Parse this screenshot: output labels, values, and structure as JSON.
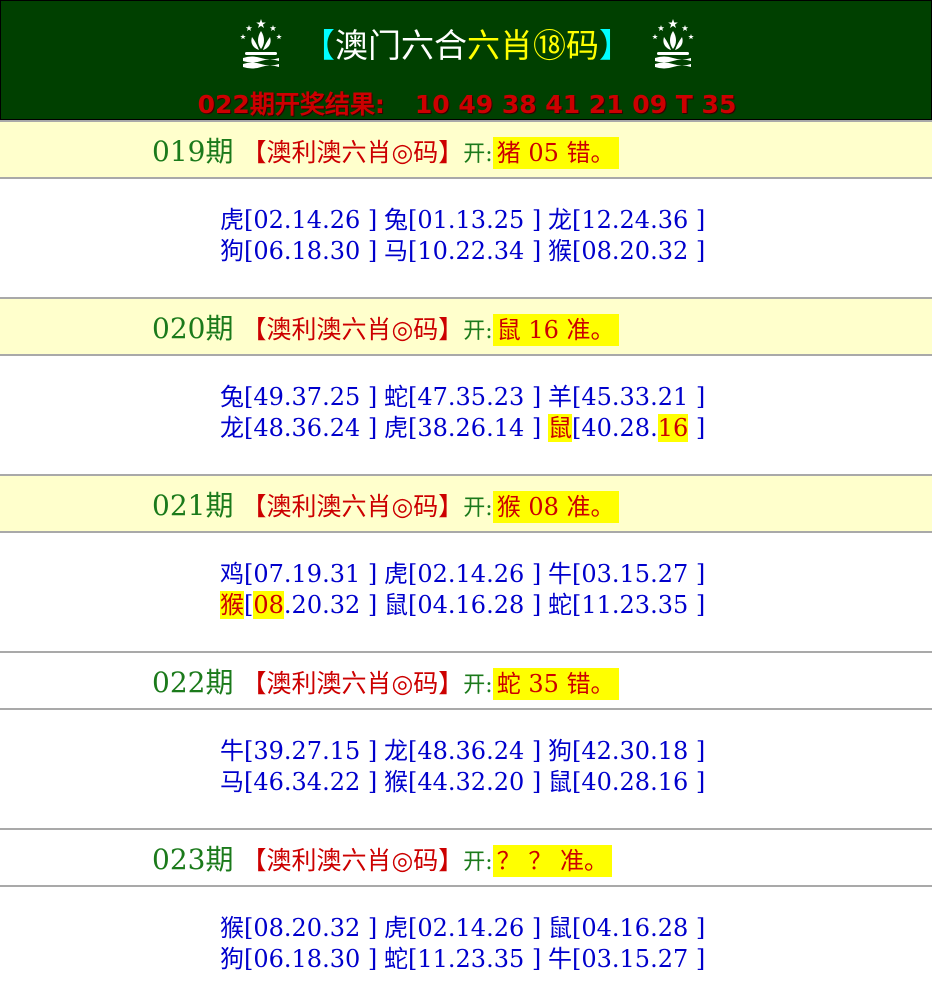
{
  "header": {
    "title_open": "【",
    "title_a": "澳门六合",
    "title_b": "六肖⑱码",
    "title_close": "】",
    "result_label": "022期开奖结果:",
    "result_numbers": "10 49 38 41 21 09 T 35"
  },
  "periods": [
    {
      "number": "019期",
      "bracket": "【澳利澳六肖◎码】",
      "kai": "开:",
      "result": "猪 05 错。",
      "head_bg": "#ffffcc",
      "rows": [
        [
          {
            "z": "虎",
            "n": [
              "[02.14.26 ]"
            ]
          },
          {
            "z": "兔",
            "n": [
              "[01.13.25 ]"
            ]
          },
          {
            "z": "龙",
            "n": [
              "[12.24.36 ]"
            ]
          }
        ],
        [
          {
            "z": "狗",
            "n": [
              "[06.18.30 ]"
            ]
          },
          {
            "z": "马",
            "n": [
              "[10.22.34 ]"
            ]
          },
          {
            "z": "猴",
            "n": [
              "[08.20.32 ]"
            ]
          }
        ]
      ]
    },
    {
      "number": "020期",
      "bracket": "【澳利澳六肖◎码】",
      "kai": "开:",
      "result": "鼠 16 准。",
      "head_bg": "#ffffcc",
      "rows": [
        [
          {
            "z": "兔",
            "n": [
              "[49.37.25 ]"
            ]
          },
          {
            "z": "蛇",
            "n": [
              "[47.35.23 ]"
            ]
          },
          {
            "z": "羊",
            "n": [
              "[45.33.21 ]"
            ]
          }
        ],
        [
          {
            "z": "龙",
            "n": [
              "[48.36.24 ]"
            ]
          },
          {
            "z": "虎",
            "n": [
              "[38.26.14 ]"
            ]
          },
          {
            "z": "鼠",
            "hit": true,
            "n": [
              "[40.28.",
              "16",
              " ]"
            ],
            "hitIndex": 1
          }
        ]
      ]
    },
    {
      "number": "021期",
      "bracket": "【澳利澳六肖◎码】",
      "kai": "开:",
      "result": "猴 08 准。",
      "head_bg": "#ffffcc",
      "rows": [
        [
          {
            "z": "鸡",
            "n": [
              "[07.19.31 ]"
            ]
          },
          {
            "z": "虎",
            "n": [
              "[02.14.26 ]"
            ]
          },
          {
            "z": "牛",
            "n": [
              "[03.15.27 ]"
            ]
          }
        ],
        [
          {
            "z": "猴",
            "hit": true,
            "n": [
              "[",
              "08",
              ".20.32 ]"
            ],
            "hitIndex": 1
          },
          {
            "z": "鼠",
            "n": [
              "[04.16.28 ]"
            ]
          },
          {
            "z": "蛇",
            "n": [
              "[11.23.35 ]"
            ]
          }
        ]
      ]
    },
    {
      "number": "022期",
      "bracket": "【澳利澳六肖◎码】",
      "kai": "开:",
      "result": "蛇 35 错。",
      "head_bg": "#ffffff",
      "rows": [
        [
          {
            "z": "牛",
            "n": [
              "[39.27.15 ]"
            ]
          },
          {
            "z": "龙",
            "n": [
              "[48.36.24 ]"
            ]
          },
          {
            "z": "狗",
            "n": [
              "[42.30.18 ]"
            ]
          }
        ],
        [
          {
            "z": "马",
            "n": [
              "[46.34.22 ]"
            ]
          },
          {
            "z": "猴",
            "n": [
              "[44.32.20 ]"
            ]
          },
          {
            "z": "鼠",
            "n": [
              "[40.28.16 ]"
            ]
          }
        ]
      ]
    },
    {
      "number": "023期",
      "bracket": "【澳利澳六肖◎码】",
      "kai": "开:",
      "result": "？ ？ 准。",
      "head_bg": "#ffffff",
      "rows": [
        [
          {
            "z": "猴",
            "n": [
              "[08.20.32 ]"
            ]
          },
          {
            "z": "虎",
            "n": [
              "[02.14.26 ]"
            ]
          },
          {
            "z": "鼠",
            "n": [
              "[04.16.28 ]"
            ]
          }
        ],
        [
          {
            "z": "狗",
            "n": [
              "[06.18.30 ]"
            ]
          },
          {
            "z": "蛇",
            "n": [
              "[11.23.35 ]"
            ]
          },
          {
            "z": "牛",
            "n": [
              "[03.15.27 ]"
            ]
          }
        ]
      ]
    }
  ]
}
